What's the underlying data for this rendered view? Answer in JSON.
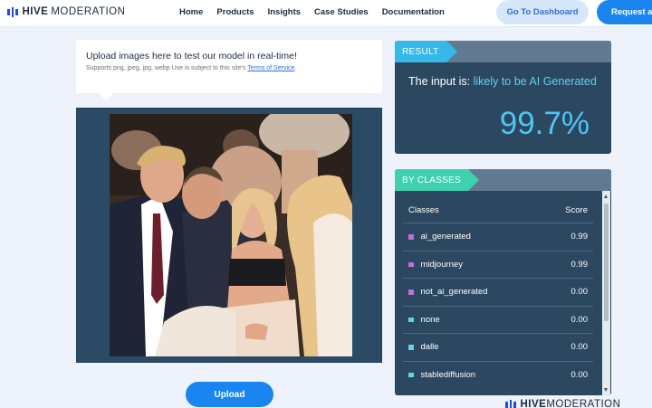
{
  "brand": {
    "bold": "HIVE",
    "rest": "MODERATION",
    "accent": "#1d4ed8"
  },
  "nav": [
    "Home",
    "Products",
    "Insights",
    "Case Studies",
    "Documentation"
  ],
  "buttons": {
    "dashboard": "Go To Dashboard",
    "request": "Request a D",
    "upload": "Upload"
  },
  "upload_tip": {
    "title": "Upload images here to test our model in real-time!",
    "sub": "Supports png, jpeg, jpg, webp Use is subject to this site's ",
    "terms": "Terms of Service",
    "period": "."
  },
  "result": {
    "tag": "RESULT",
    "prefix": "The input is: ",
    "verdict": "likely to be AI Generated",
    "percent": "99.7%"
  },
  "classes": {
    "tag": "BY CLASSES",
    "col_class": "Classes",
    "col_score": "Score",
    "rows": [
      {
        "name": "ai_generated",
        "score": "0.99",
        "color": "#c46fd9"
      },
      {
        "name": "midjourney",
        "score": "0.99",
        "color": "#c46fd9"
      },
      {
        "name": "not_ai_generated",
        "score": "0.00",
        "color": "#c46fd9"
      },
      {
        "name": "none",
        "score": "0.00",
        "color": "#5fd6e8"
      },
      {
        "name": "dalle",
        "score": "0.00",
        "color": "#5fd6e8"
      },
      {
        "name": "stablediffusion",
        "score": "0.00",
        "color": "#5fd6e8"
      }
    ]
  },
  "footer": {
    "bold": "HIVE",
    "rest": "MODERATION"
  }
}
